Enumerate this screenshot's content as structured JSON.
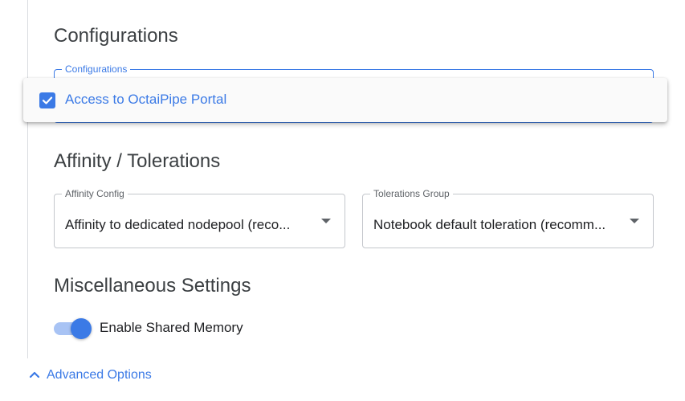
{
  "sections": {
    "configurations": {
      "title": "Configurations",
      "field_label": "Configurations",
      "menu_items": [
        {
          "label": "Access to OctaiPipe Portal",
          "checked": true
        }
      ]
    },
    "affinity": {
      "title": "Affinity / Tolerations",
      "affinity_config": {
        "label": "Affinity Config",
        "value": "Affinity to dedicated nodepool (reco..."
      },
      "tolerations_group": {
        "label": "Tolerations Group",
        "value": "Notebook default toleration (recomm..."
      }
    },
    "misc": {
      "title": "Miscellaneous Settings",
      "shared_memory": {
        "label": "Enable Shared Memory",
        "enabled": true
      }
    }
  },
  "advanced_options": {
    "label": "Advanced Options",
    "icon": "chevron-up-icon"
  },
  "colors": {
    "accent": "#3b7ae6",
    "toggle_track": "#a8c3f4",
    "text": "#202124",
    "heading": "#3c4043"
  }
}
